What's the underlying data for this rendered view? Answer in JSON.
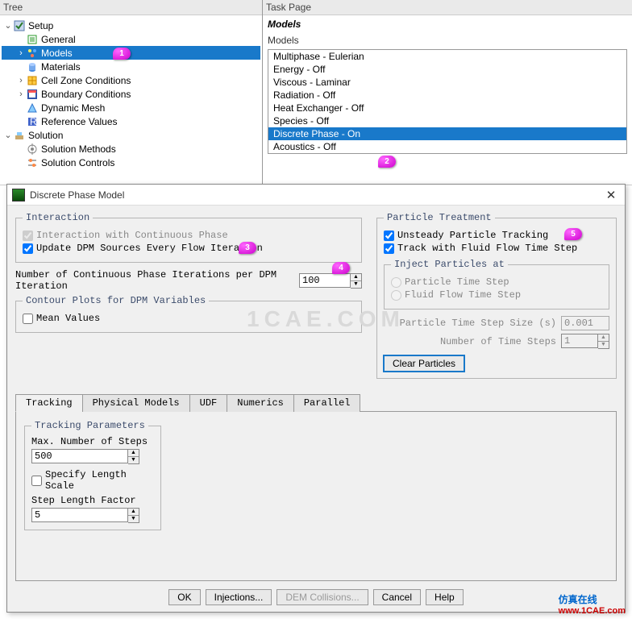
{
  "tree": {
    "header": "Tree",
    "setup": {
      "label": "Setup",
      "children": [
        {
          "label": "General",
          "icon": "general"
        },
        {
          "label": "Models",
          "icon": "models",
          "selected": true
        },
        {
          "label": "Materials",
          "icon": "materials"
        },
        {
          "label": "Cell Zone Conditions",
          "icon": "cellzone"
        },
        {
          "label": "Boundary Conditions",
          "icon": "boundary"
        },
        {
          "label": "Dynamic Mesh",
          "icon": "dynmesh"
        },
        {
          "label": "Reference Values",
          "icon": "refval"
        }
      ]
    },
    "solution": {
      "label": "Solution",
      "children": [
        {
          "label": "Solution Methods",
          "icon": "solmeth"
        },
        {
          "label": "Solution Controls",
          "icon": "solctrl"
        }
      ]
    }
  },
  "task": {
    "header": "Task Page",
    "title": "Models",
    "list_label": "Models",
    "items": [
      {
        "label": "Multiphase - Eulerian"
      },
      {
        "label": "Energy - Off"
      },
      {
        "label": "Viscous - Laminar"
      },
      {
        "label": "Radiation - Off"
      },
      {
        "label": "Heat Exchanger - Off"
      },
      {
        "label": "Species - Off"
      },
      {
        "label": "Discrete Phase - On",
        "selected": true
      },
      {
        "label": "Acoustics - Off"
      }
    ]
  },
  "dialog": {
    "title": "Discrete Phase Model",
    "interaction": {
      "legend": "Interaction",
      "continuous": "Interaction with Continuous Phase",
      "update_dpm": "Update DPM Sources Every Flow Iteration",
      "num_iter_label": "Number of Continuous Phase Iterations per DPM Iteration",
      "num_iter_value": "100"
    },
    "contour": {
      "legend": "Contour Plots for DPM Variables",
      "mean_values": "Mean Values"
    },
    "particle": {
      "legend": "Particle Treatment",
      "unsteady": "Unsteady Particle Tracking",
      "track_fluid": "Track with Fluid Flow Time Step",
      "inject_legend": "Inject Particles at",
      "inject_particle": "Particle Time Step",
      "inject_fluid": "Fluid Flow Time Step",
      "step_size_label": "Particle Time Step Size (s)",
      "step_size_value": "0.001",
      "num_steps_label": "Number of Time Steps",
      "num_steps_value": "1",
      "clear_btn": "Clear Particles"
    },
    "tabs": [
      "Tracking",
      "Physical Models",
      "UDF",
      "Numerics",
      "Parallel"
    ],
    "tracking": {
      "legend": "Tracking Parameters",
      "max_steps_label": "Max. Number of Steps",
      "max_steps_value": "500",
      "specify_length": "Specify Length Scale",
      "step_factor_label": "Step Length Factor",
      "step_factor_value": "5"
    },
    "buttons": {
      "ok": "OK",
      "injections": "Injections...",
      "dem": "DEM Collisions...",
      "cancel": "Cancel",
      "help": "Help"
    }
  },
  "markers": {
    "m1": "1",
    "m2": "2",
    "m3": "3",
    "m4": "4",
    "m5": "5"
  },
  "watermark": "1CAE.COM",
  "brand": {
    "cn": "仿真在线",
    "url": "www.1CAE.com"
  }
}
